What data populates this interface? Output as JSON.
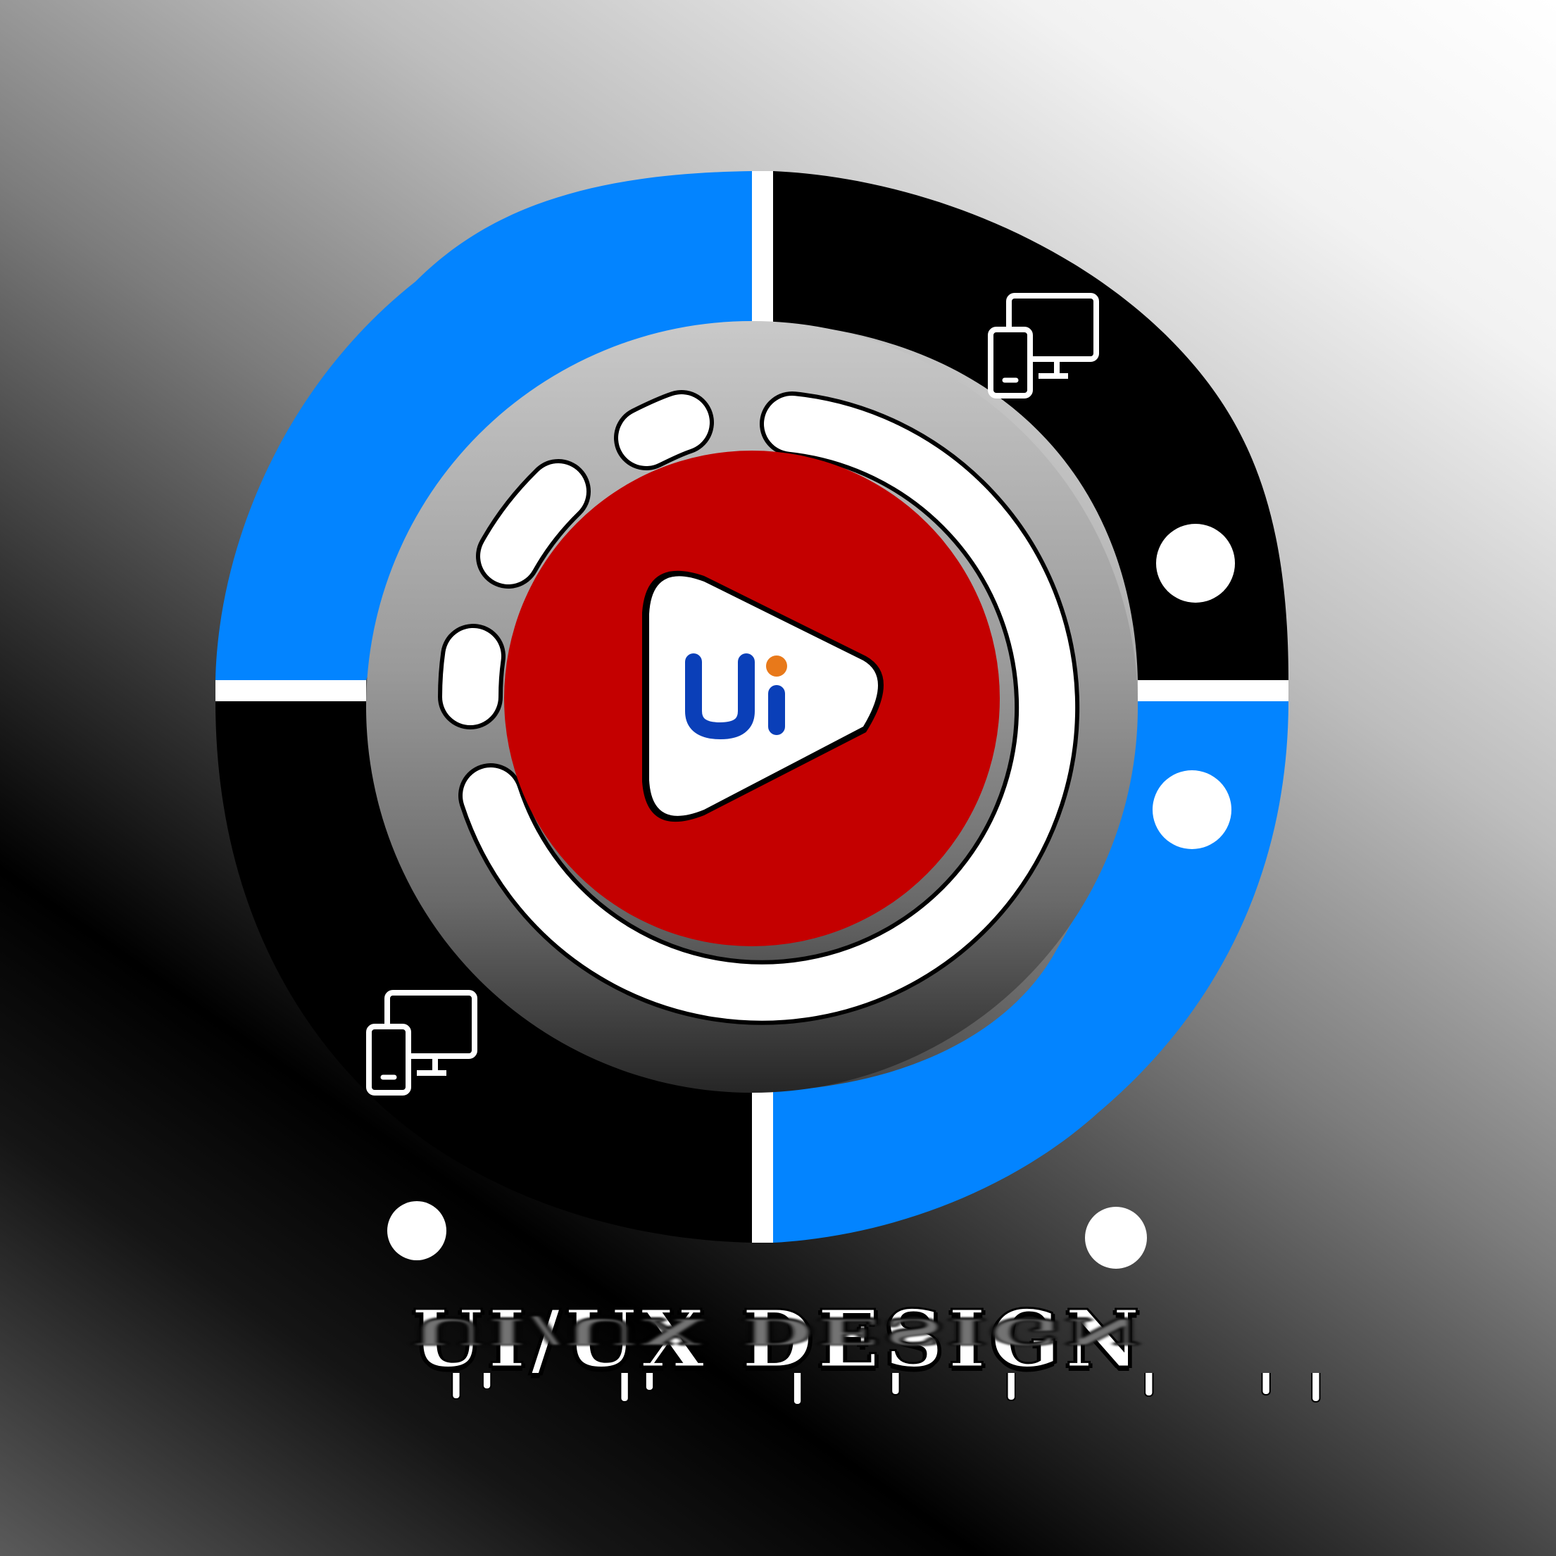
{
  "title": {
    "text": "UI/UX DESIGN"
  },
  "logo": {
    "letter_u": "U",
    "letter_i": "i"
  },
  "colors": {
    "ring_blue": "#0384ff",
    "ring_black": "#000000",
    "center_red": "#c40000",
    "logo_blue": "#0a3fb8",
    "logo_dot_orange": "#e8791a",
    "white": "#ffffff"
  },
  "icons": {
    "top_right": "responsive-devices-icon",
    "bottom_left": "responsive-devices-icon",
    "center": "play-icon"
  }
}
